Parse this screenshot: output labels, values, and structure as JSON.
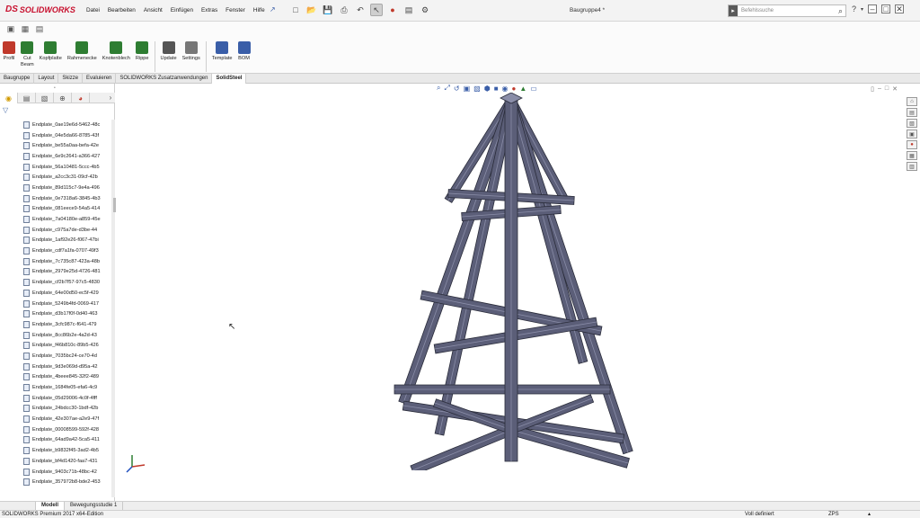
{
  "app": {
    "brand": "SOLIDWORKS",
    "brand_mark": "DS",
    "document_title": "Baugruppe4 *"
  },
  "menu": [
    "Datei",
    "Bearbeiten",
    "Ansicht",
    "Einfügen",
    "Extras",
    "Fenster",
    "Hilfe"
  ],
  "search": {
    "placeholder": "Befehlssuche"
  },
  "ribbon": {
    "tools": [
      {
        "label": "Profil",
        "icon": "profile-icon",
        "color": "#c0392b"
      },
      {
        "label": "Cut\nBeam",
        "icon": "cut-beam-icon",
        "color": "#2e7d32"
      },
      {
        "label": "Kopfplatte",
        "icon": "end-plate-icon",
        "color": "#2e7d32"
      },
      {
        "label": "Rahmenecke",
        "icon": "frame-corner-icon",
        "color": "#2e7d32"
      },
      {
        "label": "Knotenblech",
        "icon": "gusset-icon",
        "color": "#2e7d32"
      },
      {
        "label": "Rippe",
        "icon": "rib-icon",
        "color": "#2e7d32"
      },
      {
        "label": "Update",
        "icon": "update-icon",
        "color": "#555555"
      },
      {
        "label": "Settings",
        "icon": "settings-icon",
        "color": "#777777"
      },
      {
        "label": "Template",
        "icon": "template-icon",
        "color": "#3a5ea8"
      },
      {
        "label": "BOM",
        "icon": "bom-icon",
        "color": "#3a5ea8"
      }
    ]
  },
  "tabs": [
    {
      "label": "Baugruppe",
      "active": false
    },
    {
      "label": "Layout",
      "active": false
    },
    {
      "label": "Skizze",
      "active": false
    },
    {
      "label": "Evaluieren",
      "active": false
    },
    {
      "label": "SOLIDWORKS Zusatzanwendungen",
      "active": false
    },
    {
      "label": "SolidSteel",
      "active": true
    }
  ],
  "tree": {
    "items": [
      "Endplate_0ae19e6d-5462-48c",
      "Endplate_04e5da66-8785-43f",
      "Endplate_be55a0aa-befa-42e",
      "Endplate_6e9c2641-a366-427",
      "Endplate_56a10481-5ccc-4b5",
      "Endplate_a2cc3c31-09cf-42b",
      "Endplate_89d115c7-9e4a-496",
      "Endplate_0e7318a6-3845-4b3",
      "Endplate_081eece9-54a5-414",
      "Endplate_7a04180e-a859-45e",
      "Endplate_c975a7de-d3be-44",
      "Endplate_1af92e26-f067-47bi",
      "Endplate_cdf7a1fa-0707-49f3",
      "Endplate_7c735c87-423a-48b",
      "Endplate_2979e25d-4726-481",
      "Endplate_cf2b7f57-97c5-4830",
      "Endplate_64e00d50-ec5f-429",
      "Endplate_5249b4fd-0069-417",
      "Endplate_d3b17f0f-0d40-463",
      "Endplate_3cfc987c-f641-479",
      "Endplate_8cc86b2e-4a2d-43",
      "Endplate_f46b810c-89b5-426",
      "Endplate_7035bc24-ce70-4d",
      "Endplate_9d3e069d-d95a-42",
      "Endplate_4beee845-32f2-489",
      "Endplate_1684fe05-efa6-4c9",
      "Endplate_05d29006-4c0f-4fff",
      "Endplate_24bdcc30-1bdf-42b",
      "Endplate_42e307ae-a2e9-47f",
      "Endplate_00008599-592f-428",
      "Endplate_64ad9a42-5ca5-411",
      "Endplate_b9832f45-3ad2-4b5",
      "Endplate_bf4d1420-faa7-431",
      "Endplate_9403c71b-48bc-42",
      "Endplate_357972b8-bde2-453"
    ]
  },
  "bottom_tabs": [
    {
      "label": "Modell",
      "active": true
    },
    {
      "label": "Bewegungsstudie 1",
      "active": false
    }
  ],
  "status": {
    "edition": "SOLIDWORKS Premium 2017 x64-Edition",
    "definition": "Voll definiert",
    "units": "ZPS"
  },
  "colors": {
    "brand": "#c8102e",
    "beam_face": "#5b5e78",
    "beam_edge": "#2a2c3a",
    "beam_light": "#8a8da8"
  }
}
